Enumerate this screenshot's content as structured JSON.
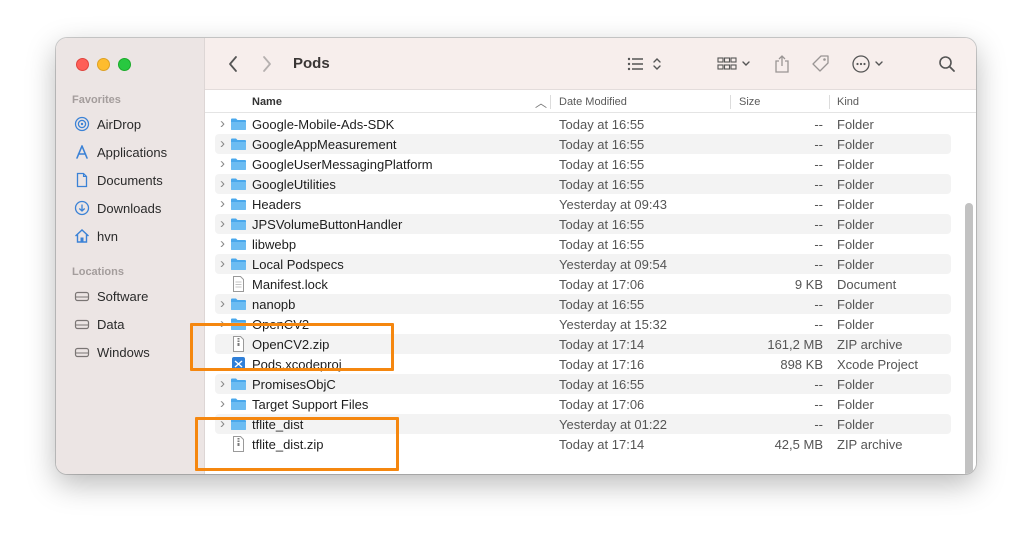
{
  "window": {
    "traffic": [
      "close",
      "minimize",
      "zoom"
    ]
  },
  "sidebar": {
    "favorites_label": "Favorites",
    "favorites": [
      {
        "label": "AirDrop",
        "icon": "airdrop-icon"
      },
      {
        "label": "Applications",
        "icon": "applications-icon"
      },
      {
        "label": "Documents",
        "icon": "document-icon"
      },
      {
        "label": "Downloads",
        "icon": "downloads-icon"
      },
      {
        "label": "hvn",
        "icon": "home-icon"
      }
    ],
    "locations_label": "Locations",
    "locations": [
      {
        "label": "Software",
        "icon": "disk-icon"
      },
      {
        "label": "Data",
        "icon": "disk-icon"
      },
      {
        "label": "Windows",
        "icon": "disk-icon"
      }
    ]
  },
  "toolbar": {
    "title": "Pods"
  },
  "columns": {
    "name": "Name",
    "date": "Date Modified",
    "size": "Size",
    "kind": "Kind"
  },
  "rows": [
    {
      "name": "Google-Mobile-Ads-SDK",
      "date": "Today at 16:55",
      "size": "--",
      "kind": "Folder",
      "type": "folder"
    },
    {
      "name": "GoogleAppMeasurement",
      "date": "Today at 16:55",
      "size": "--",
      "kind": "Folder",
      "type": "folder"
    },
    {
      "name": "GoogleUserMessagingPlatform",
      "date": "Today at 16:55",
      "size": "--",
      "kind": "Folder",
      "type": "folder"
    },
    {
      "name": "GoogleUtilities",
      "date": "Today at 16:55",
      "size": "--",
      "kind": "Folder",
      "type": "folder"
    },
    {
      "name": "Headers",
      "date": "Yesterday at 09:43",
      "size": "--",
      "kind": "Folder",
      "type": "folder"
    },
    {
      "name": "JPSVolumeButtonHandler",
      "date": "Today at 16:55",
      "size": "--",
      "kind": "Folder",
      "type": "folder"
    },
    {
      "name": "libwebp",
      "date": "Today at 16:55",
      "size": "--",
      "kind": "Folder",
      "type": "folder"
    },
    {
      "name": "Local Podspecs",
      "date": "Yesterday at 09:54",
      "size": "--",
      "kind": "Folder",
      "type": "folder"
    },
    {
      "name": "Manifest.lock",
      "date": "Today at 17:06",
      "size": "9 KB",
      "kind": "Document",
      "type": "doc"
    },
    {
      "name": "nanopb",
      "date": "Today at 16:55",
      "size": "--",
      "kind": "Folder",
      "type": "folder"
    },
    {
      "name": "OpenCV2",
      "date": "Yesterday at 15:32",
      "size": "--",
      "kind": "Folder",
      "type": "folder"
    },
    {
      "name": "OpenCV2.zip",
      "date": "Today at 17:14",
      "size": "161,2 MB",
      "kind": "ZIP archive",
      "type": "zip"
    },
    {
      "name": "Pods.xcodeproj",
      "date": "Today at 17:16",
      "size": "898 KB",
      "kind": "Xcode Project",
      "type": "xcode"
    },
    {
      "name": "PromisesObjC",
      "date": "Today at 16:55",
      "size": "--",
      "kind": "Folder",
      "type": "folder"
    },
    {
      "name": "Target Support Files",
      "date": "Today at 17:06",
      "size": "--",
      "kind": "Folder",
      "type": "folder"
    },
    {
      "name": "tflite_dist",
      "date": "Yesterday at 01:22",
      "size": "--",
      "kind": "Folder",
      "type": "folder"
    },
    {
      "name": "tflite_dist.zip",
      "date": "Today at 17:14",
      "size": "42,5 MB",
      "kind": "ZIP archive",
      "type": "zip"
    }
  ],
  "colors": {
    "highlight": "#f5870f",
    "folder": "#4aa8ec",
    "sidebar_icon": "#3b82d6"
  }
}
